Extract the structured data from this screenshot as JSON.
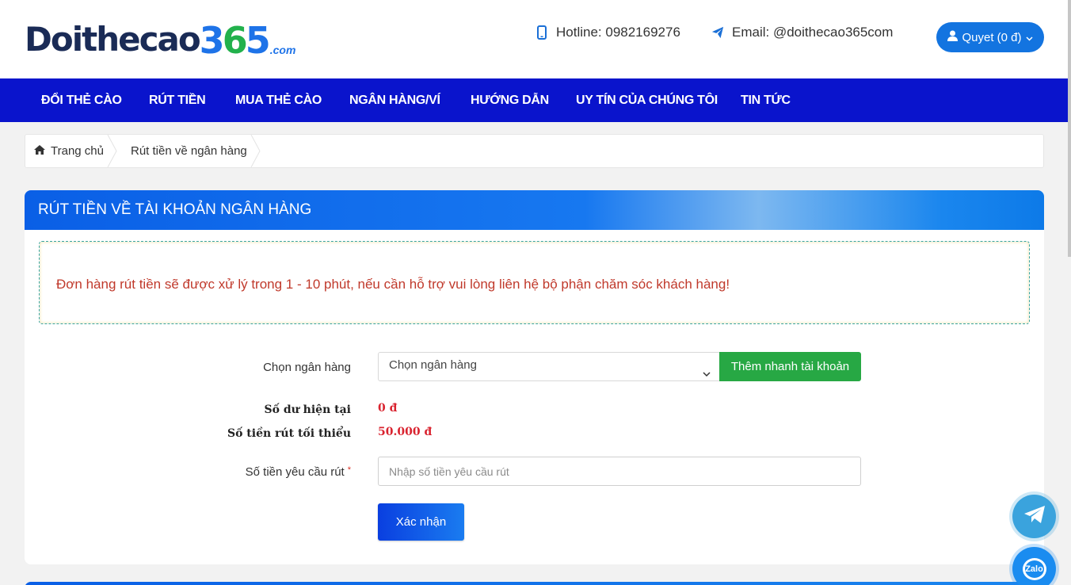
{
  "brand": {
    "logo_text": "Doithecao",
    "logo_digits": [
      "3",
      "6",
      "5"
    ],
    "logo_suffix": ".com",
    "colors": {
      "navy": "#1a2b56",
      "blue": "#1e73e8",
      "green": "#22b14c"
    }
  },
  "header": {
    "hotline": "Hotline: 0982169276",
    "email": "Email: @doithecao365com",
    "user_label": "Quyet (0 đ)",
    "hotline_icon": "phone-icon",
    "email_icon": "paper-plane-icon",
    "user_icon": "user-icon"
  },
  "nav": {
    "items": [
      {
        "label": "ĐỔI THẺ CÀO"
      },
      {
        "label": "RÚT TIỀN"
      },
      {
        "label": "MUA THẺ CÀO"
      },
      {
        "label": "NGÂN HÀNG/VÍ"
      },
      {
        "label": "HƯỚNG DẪN"
      },
      {
        "label": "UY TÍN CỦA CHÚNG TÔI"
      },
      {
        "label": "TIN TỨC"
      }
    ],
    "color": "#0a14cc"
  },
  "breadcrumb": {
    "home": "Trang chủ",
    "current": "Rút tiền về ngân hàng",
    "home_icon": "home-icon"
  },
  "panel": {
    "title": "RÚT TIỀN VỀ TÀI KHOẢN NGÂN HÀNG",
    "notice": "Đơn hàng rút tiền sẽ được xử lý trong 1 - 10 phút, nếu cần hỗ trợ vui lòng liên hệ bộ phận chăm sóc khách hàng!"
  },
  "form": {
    "bank_label": "Chọn ngân hàng",
    "bank_selected": "Chọn ngân hàng",
    "add_account_button": "Thêm nhanh tài khoản",
    "balance_label": "Số dư hiện tại",
    "balance_value": "0 đ",
    "min_label": "Số tiền rút tối thiểu",
    "min_value": "50.000 đ",
    "amount_label": "Số tiền yêu cầu rút",
    "amount_required_mark": "*",
    "amount_placeholder": "Nhập số tiền yêu cầu rút",
    "submit_button": "Xác nhận"
  },
  "floating": {
    "telegram_icon": "telegram-icon",
    "zalo_icon": "zalo-icon",
    "zalo_text": "Zalo"
  }
}
